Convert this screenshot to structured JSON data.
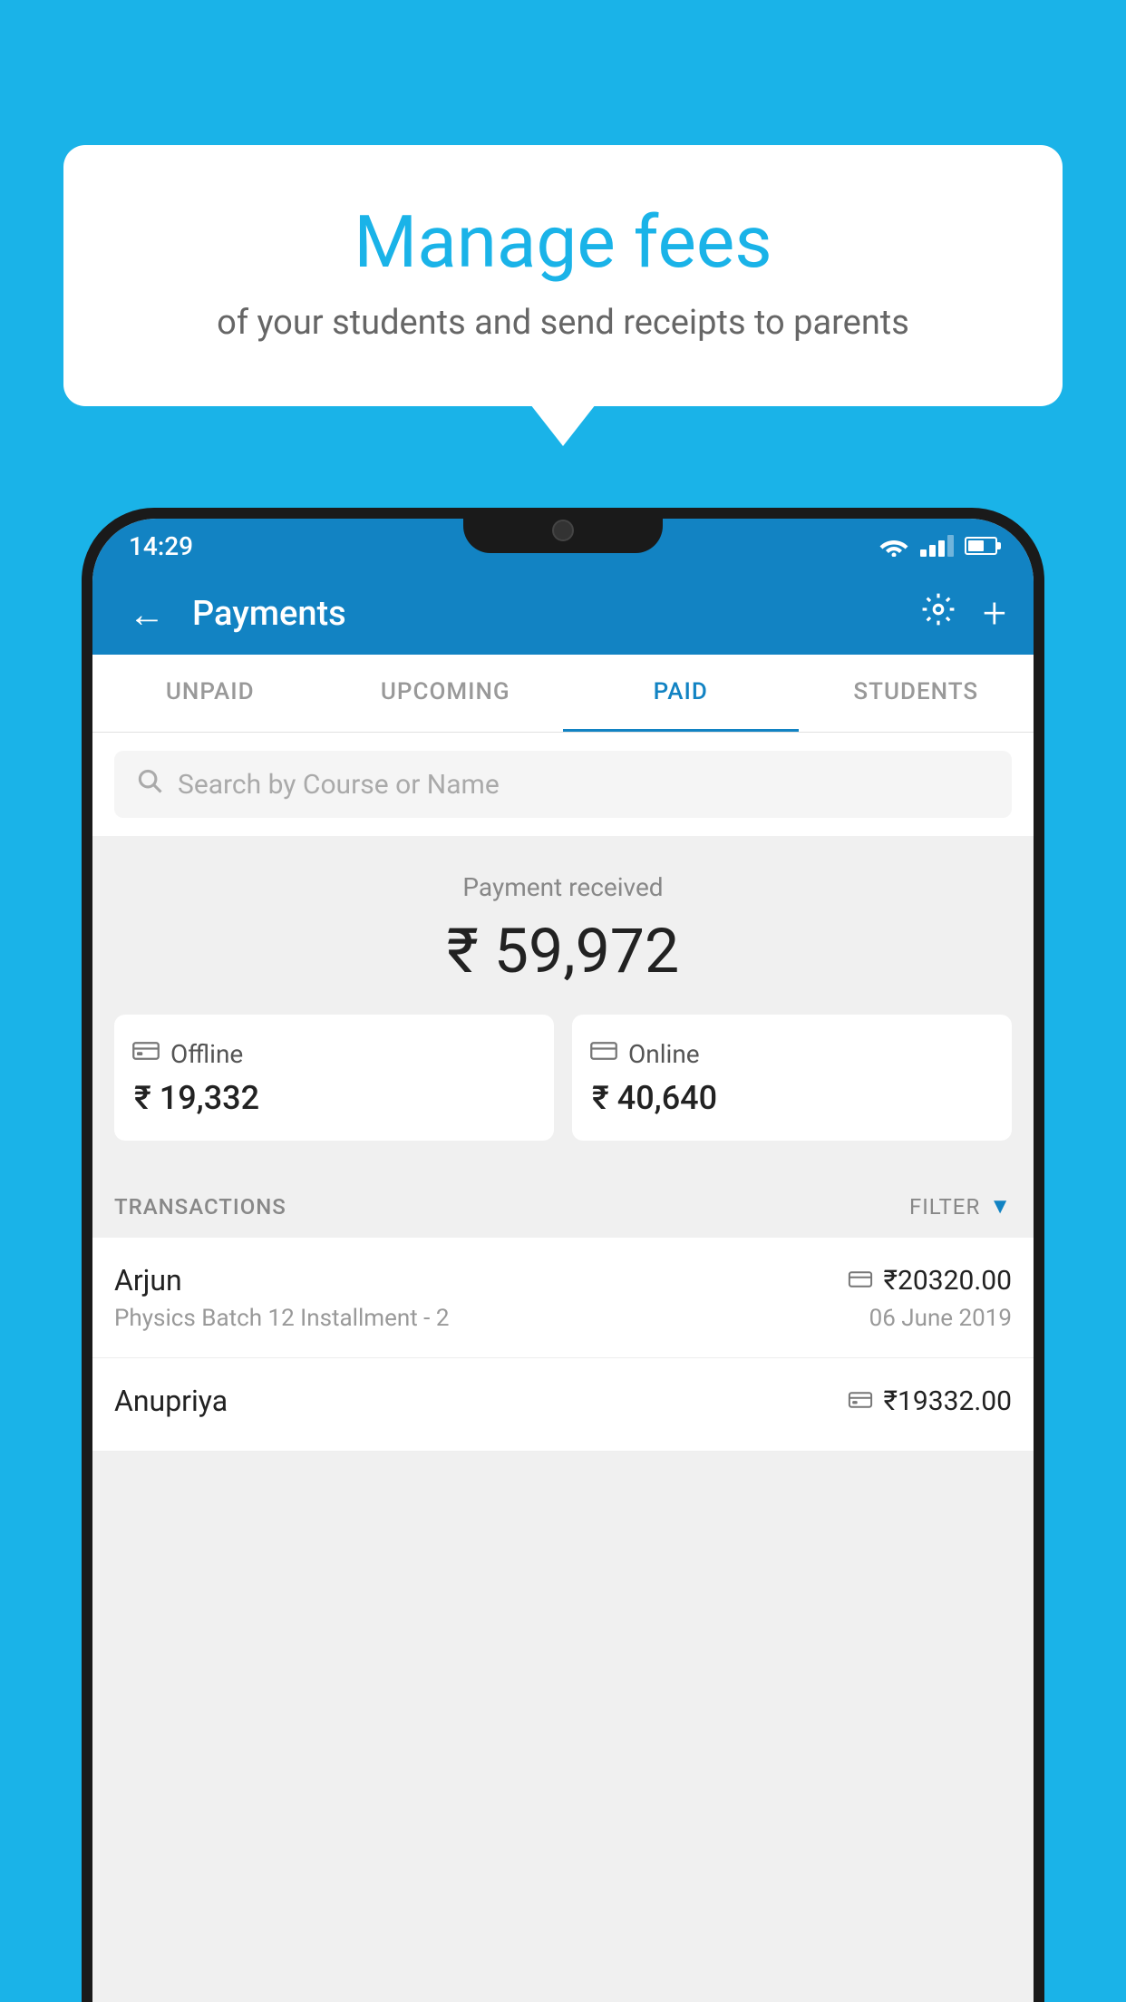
{
  "background_color": "#1ab3e8",
  "bubble": {
    "title": "Manage fees",
    "subtitle": "of your students and send receipts to parents"
  },
  "status_bar": {
    "time": "14:29"
  },
  "header": {
    "title": "Payments",
    "back_label": "←",
    "plus_label": "+"
  },
  "tabs": [
    {
      "label": "UNPAID",
      "active": false
    },
    {
      "label": "UPCOMING",
      "active": false
    },
    {
      "label": "PAID",
      "active": true
    },
    {
      "label": "STUDENTS",
      "active": false
    }
  ],
  "search": {
    "placeholder": "Search by Course or Name"
  },
  "payment_summary": {
    "label": "Payment received",
    "amount": "₹ 59,972",
    "offline": {
      "type": "Offline",
      "amount": "₹ 19,332"
    },
    "online": {
      "type": "Online",
      "amount": "₹ 40,640"
    }
  },
  "transactions": {
    "label": "TRANSACTIONS",
    "filter_label": "FILTER",
    "items": [
      {
        "name": "Arjun",
        "detail": "Physics Batch 12 Installment - 2",
        "amount": "₹20320.00",
        "date": "06 June 2019",
        "icon": "card"
      },
      {
        "name": "Anupriya",
        "detail": "",
        "amount": "₹19332.00",
        "date": "",
        "icon": "cash"
      }
    ]
  }
}
